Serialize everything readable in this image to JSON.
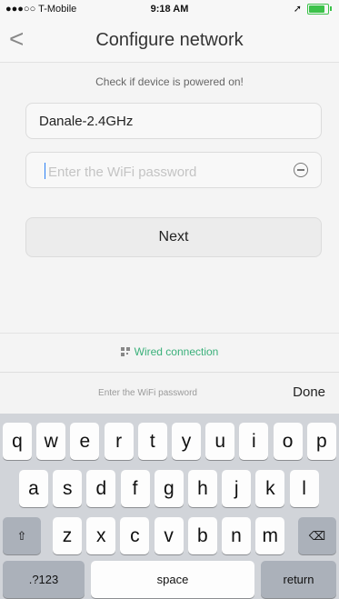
{
  "status_bar": {
    "carrier": "●●●○○ T-Mobile",
    "time": "9:18 AM",
    "location_glyph": "➚",
    "icons": [
      "wifi-icon",
      "location-icon",
      "battery-icon"
    ]
  },
  "nav": {
    "back_glyph": "<",
    "title": "Configure network"
  },
  "form": {
    "hint": "Check if device is powered on!",
    "ssid": "Danale-2.4GHz",
    "password_placeholder": "Enter the WiFi password",
    "password_value": "",
    "next_label": "Next"
  },
  "wired": {
    "label": "Wired connection"
  },
  "accessory": {
    "hint": "Enter the WiFi password",
    "done_label": "Done"
  },
  "keyboard": {
    "row1": [
      "q",
      "w",
      "e",
      "r",
      "t",
      "y",
      "u",
      "i",
      "o",
      "p"
    ],
    "row2": [
      "a",
      "s",
      "d",
      "f",
      "g",
      "h",
      "j",
      "k",
      "l"
    ],
    "row3": [
      "z",
      "x",
      "c",
      "v",
      "b",
      "n",
      "m"
    ],
    "shift_glyph": "⇧",
    "delete_glyph": "⌫",
    "mode_label": ".?123",
    "space_label": "space",
    "return_label": "return"
  },
  "colors": {
    "accent_green": "#3ab07a",
    "caret_blue": "#2a7ff5",
    "battery_green": "#3cc24a"
  }
}
